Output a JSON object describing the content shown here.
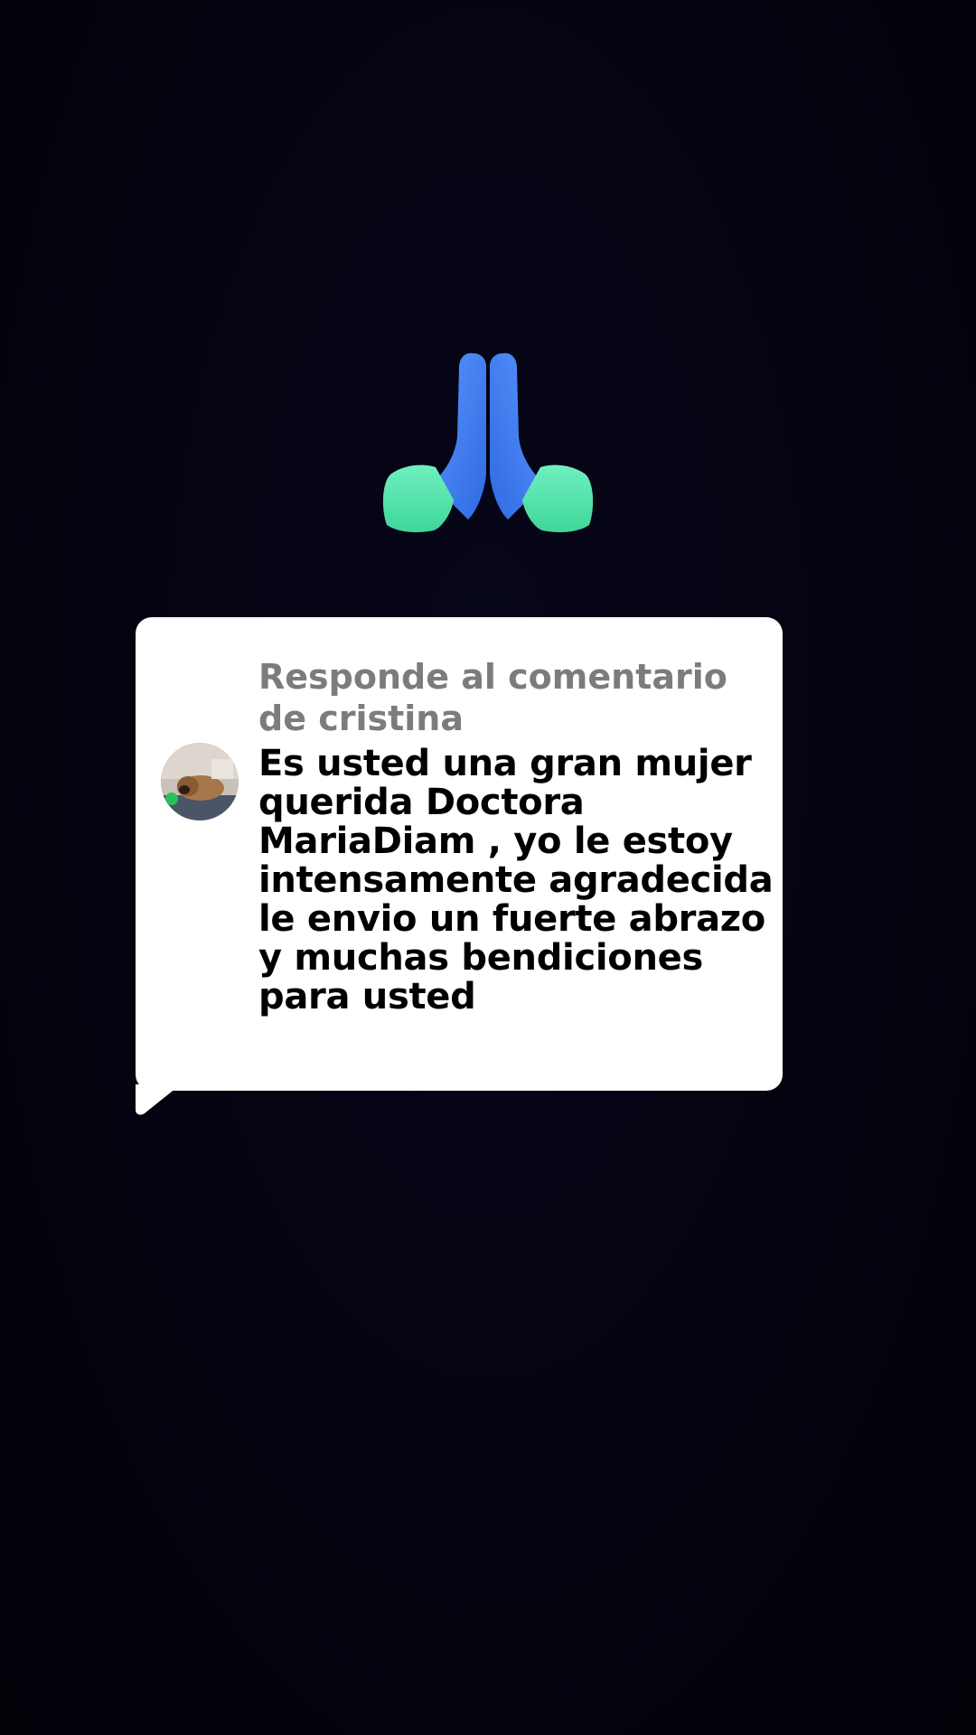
{
  "colors": {
    "background": "#04030f",
    "bubble": "#ffffff",
    "reply_label": "#7c7c7c",
    "comment_text": "#000000",
    "emoji_blue": "#3f7ff2",
    "emoji_green": "#5ee8b0"
  },
  "emoji": {
    "icon": "folded-hands-icon"
  },
  "reply": {
    "label": "Responde al comentario de cristina",
    "avatar_icon": "avatar-dog-photo",
    "comment": "Es usted una gran mujer querida Doctora MariaDiam , yo le estoy intensamente agradecida le envio un fuerte abrazo y muchas bendiciones para usted"
  }
}
